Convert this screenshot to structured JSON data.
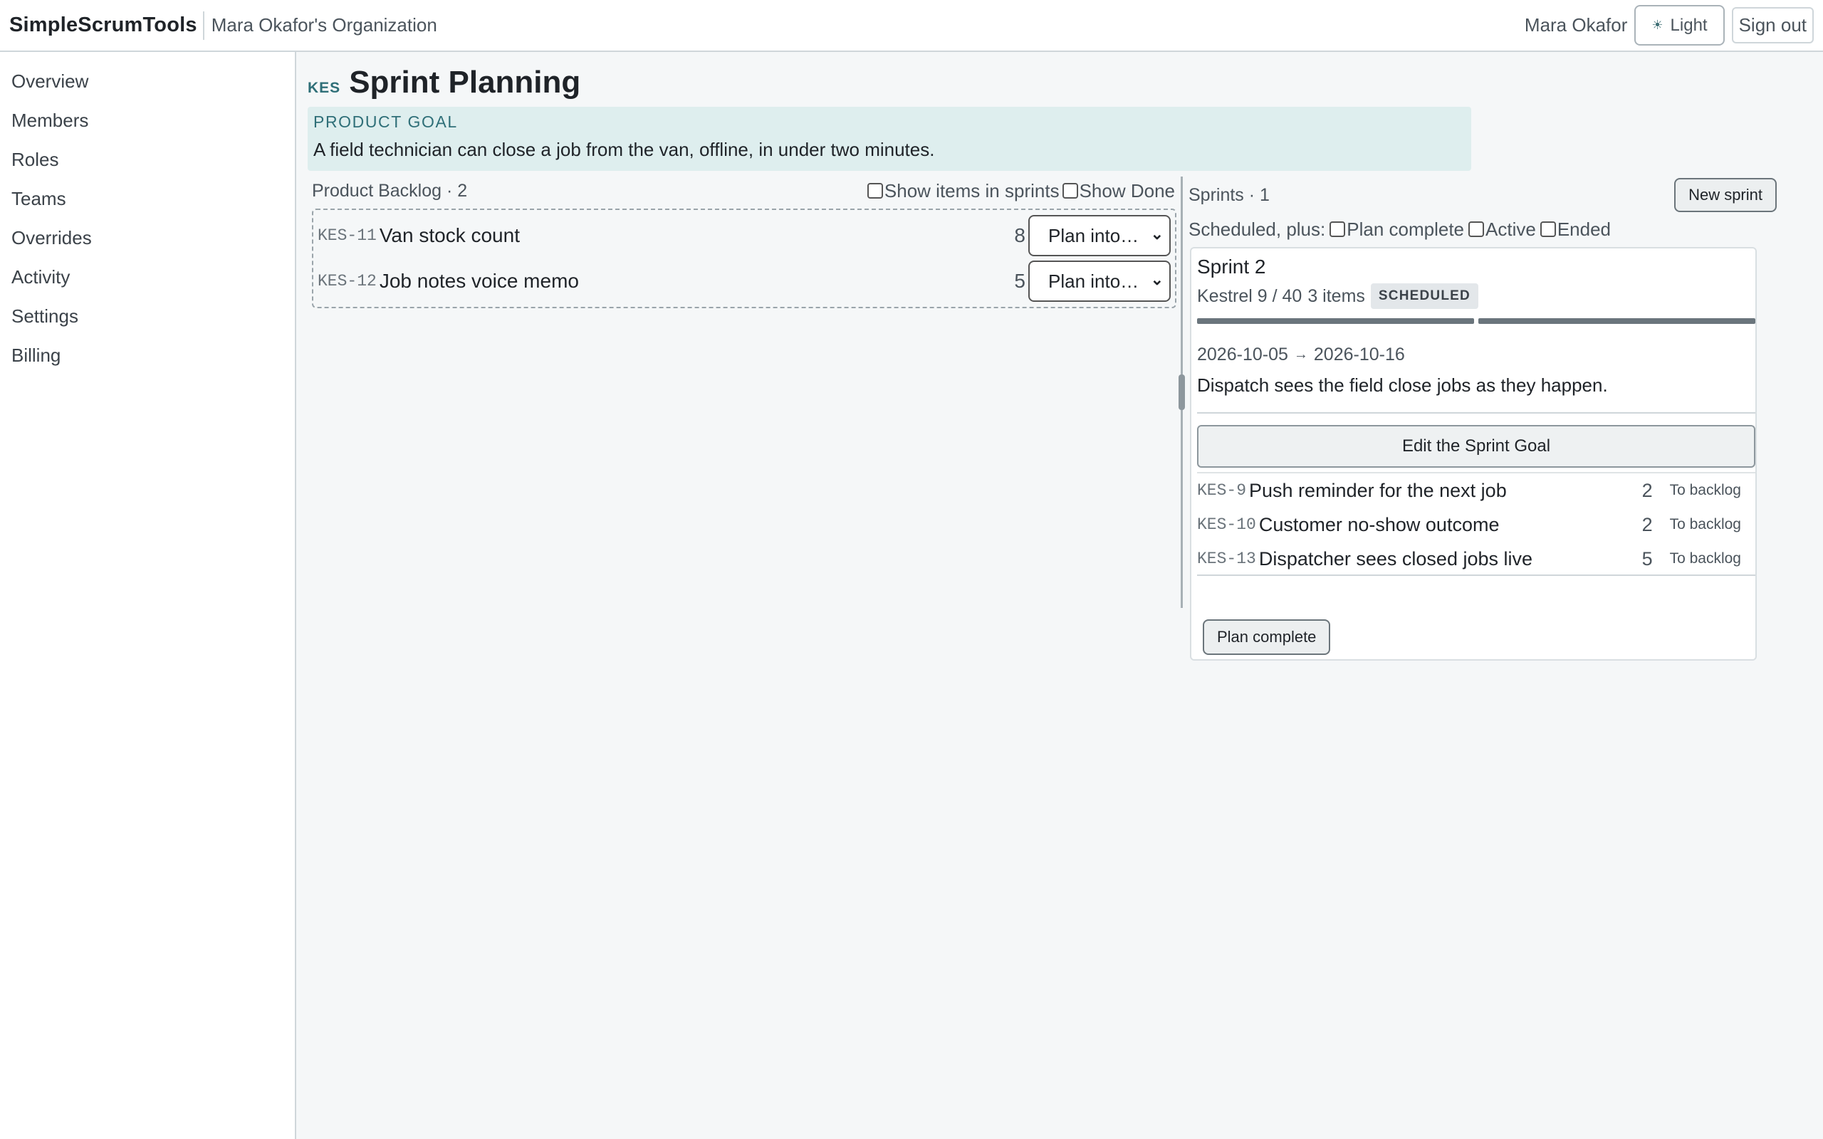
{
  "header": {
    "brand": "SimpleScrumTools",
    "organization": "Mara Okafor's Organization",
    "user_name": "Mara Okafor",
    "theme_label": "Light",
    "theme_icon": "sun-icon",
    "signout_label": "Sign out"
  },
  "sidebar": {
    "items": [
      {
        "label": "Overview"
      },
      {
        "label": "Members"
      },
      {
        "label": "Roles"
      },
      {
        "label": "Teams"
      },
      {
        "label": "Overrides"
      },
      {
        "label": "Activity"
      },
      {
        "label": "Settings"
      },
      {
        "label": "Billing"
      }
    ]
  },
  "page": {
    "project_key": "KES",
    "title": "Sprint Planning"
  },
  "product_goal": {
    "label": "PRODUCT GOAL",
    "text": "A field technician can close a job from the van, offline, in under two minutes."
  },
  "backlog": {
    "title": "Product Backlog · 2",
    "filters": {
      "show_in_sprints": "Show items in sprints",
      "show_done": "Show Done"
    },
    "items": [
      {
        "key": "KES-11",
        "title": "Van stock count",
        "points": "8",
        "select": "Plan into…"
      },
      {
        "key": "KES-12",
        "title": "Job notes voice memo",
        "points": "5",
        "select": "Plan into…"
      }
    ]
  },
  "sprints": {
    "title": "Sprints · 1",
    "new_sprint_label": "New sprint",
    "filter_prefix": "Scheduled, plus:",
    "filters": {
      "plan_complete": "Plan complete",
      "active": "Active",
      "ended": "Ended"
    },
    "card": {
      "name": "Sprint 2",
      "team_capacity": "Kestrel 9 / 40",
      "item_count": "3 items",
      "status": "SCHEDULED",
      "capacity_used_fraction": 0.225,
      "start_date": "2026-10-05",
      "arrow": "→",
      "end_date": "2026-10-16",
      "goal": "Dispatch sees the field close jobs as they happen.",
      "edit_goal_label": "Edit the Sprint Goal",
      "items": [
        {
          "key": "KES-9",
          "title": "Push reminder for the next job",
          "points": "2",
          "action": "To backlog"
        },
        {
          "key": "KES-10",
          "title": "Customer no-show outcome",
          "points": "2",
          "action": "To backlog"
        },
        {
          "key": "KES-13",
          "title": "Dispatcher sees closed jobs live",
          "points": "5",
          "action": "To backlog"
        }
      ],
      "plan_complete_label": "Plan complete"
    }
  }
}
